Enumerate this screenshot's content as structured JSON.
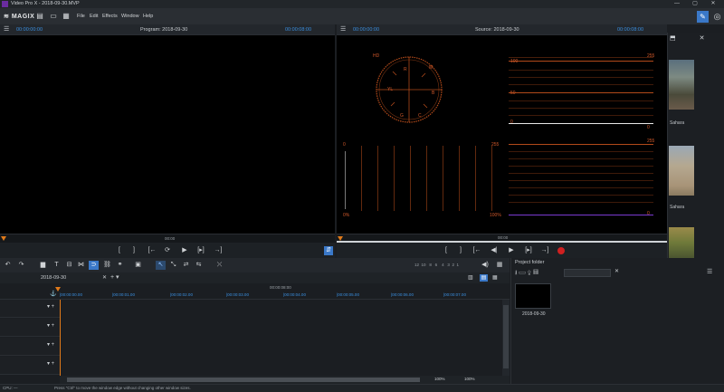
{
  "window": {
    "title": "Video Pro X - 2018-09-30.MVP"
  },
  "menu": {
    "brand": "MAGIX",
    "items": [
      "File",
      "Edit",
      "Effects",
      "Window",
      "Help"
    ]
  },
  "program_monitor": {
    "timecode_left": "00:00:00:00",
    "title": "Program: 2018-09-30",
    "timecode_right": "00:00:08:00",
    "ruler_time": "00:00"
  },
  "source_monitor": {
    "timecode_left": "00:00:00:00",
    "title": "Source: 2018-09-30",
    "timecode_right": "00:00:08:00",
    "ruler_time": "00:00"
  },
  "vectorscope": {
    "label_hd": "HD",
    "labels": [
      "R",
      "M",
      "YL",
      "B",
      "G",
      "C"
    ]
  },
  "waveform": {
    "top_labels": [
      "100",
      "255"
    ],
    "mid_label": "50",
    "zero_labels": [
      "0",
      "0"
    ],
    "histo_top": [
      "0",
      "255",
      "255"
    ],
    "histo_bottom": [
      "0%",
      "100%",
      "0"
    ]
  },
  "sidebar": {
    "items": [
      {
        "label": "Sahara"
      },
      {
        "label": "Sahara"
      }
    ]
  },
  "timeline": {
    "tab_label": "2018-09-30",
    "ruler_labels": [
      "|00:00:00.00",
      "|00:00:01.00",
      "|00:00:02.00",
      "|00:00:03.00",
      "|00:00:04.00",
      "|00:00:05.00",
      "|00:00:06.00",
      "|00:00:07.00"
    ],
    "ruler_center": "00:00:08:00",
    "zoom_values": [
      "12",
      "10",
      "8",
      "6",
      "4",
      "3",
      "2",
      "1"
    ],
    "zoom_percent_left": "100%",
    "zoom_percent_right": "100%"
  },
  "project_folder": {
    "title": "Project folder",
    "item_label": "2018-09-30"
  },
  "status": {
    "cpu": "CPU: —",
    "hint": "Press \"Ctrl\" to move the window edge without changing other window sizes."
  },
  "colors": {
    "accent_blue": "#3a8fe0",
    "playhead_orange": "#e07a1a",
    "scope_orange": "#b24a1a",
    "record_red": "#d02020"
  }
}
